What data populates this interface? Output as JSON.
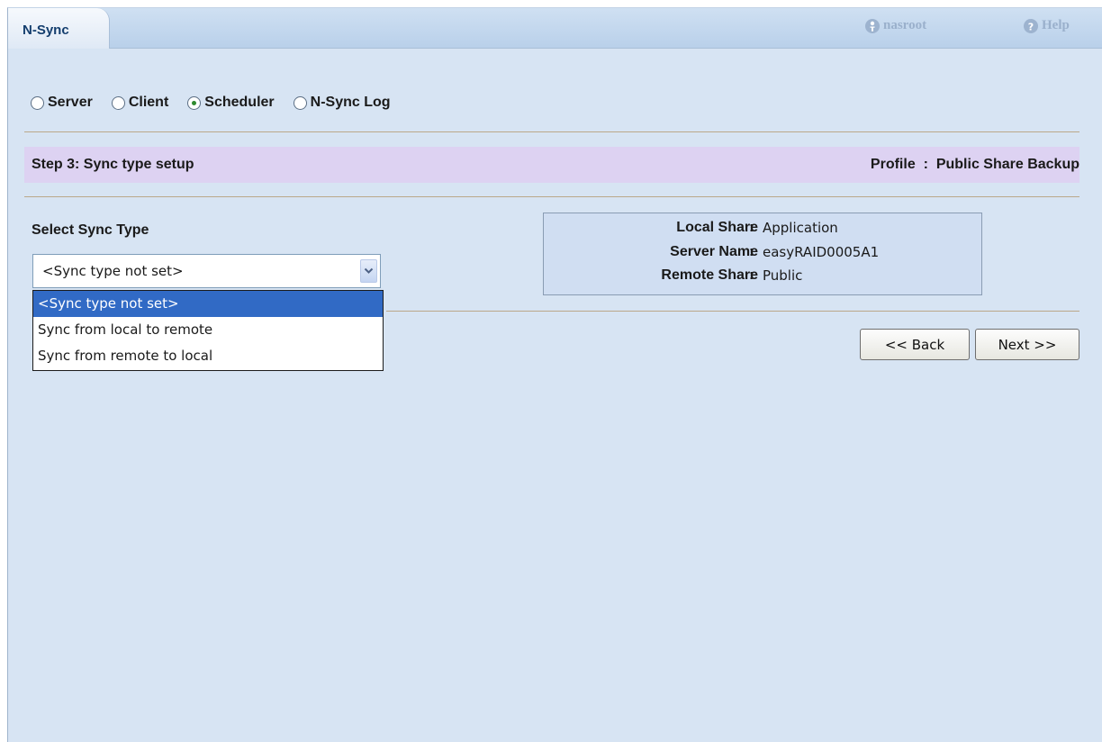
{
  "header": {
    "tab_label": "N-Sync",
    "user_label": "nasroot",
    "help_label": "Help"
  },
  "mode": {
    "options": [
      "Server",
      "Client",
      "Scheduler",
      "N-Sync Log"
    ],
    "selected": "Scheduler"
  },
  "step": {
    "title": "Step 3:  Sync type setup",
    "profile_label": "Profile",
    "profile_name": "Public Share Backup"
  },
  "sync": {
    "label": "Select Sync Type",
    "current_value": "<Sync type not set>",
    "options": [
      "<Sync type not set>",
      "Sync from local to remote",
      "Sync from remote to local"
    ],
    "highlighted": "<Sync type not set>"
  },
  "info": {
    "rows": [
      {
        "key": "Local Share",
        "value": "Application"
      },
      {
        "key": "Server Name",
        "value": "easyRAID0005A1"
      },
      {
        "key": "Remote Share",
        "value": "Public"
      }
    ]
  },
  "buttons": {
    "back": "<< Back",
    "next": "Next >>"
  },
  "icons": {
    "user": "user-icon",
    "help": "help-icon",
    "dropdown": "chevron-down-icon"
  },
  "colors": {
    "background": "#d7e4f3",
    "step_bar": "#ddd2f2",
    "info_box": "#d0def2",
    "selection": "#316ac5",
    "tab_text": "#143e6e"
  }
}
